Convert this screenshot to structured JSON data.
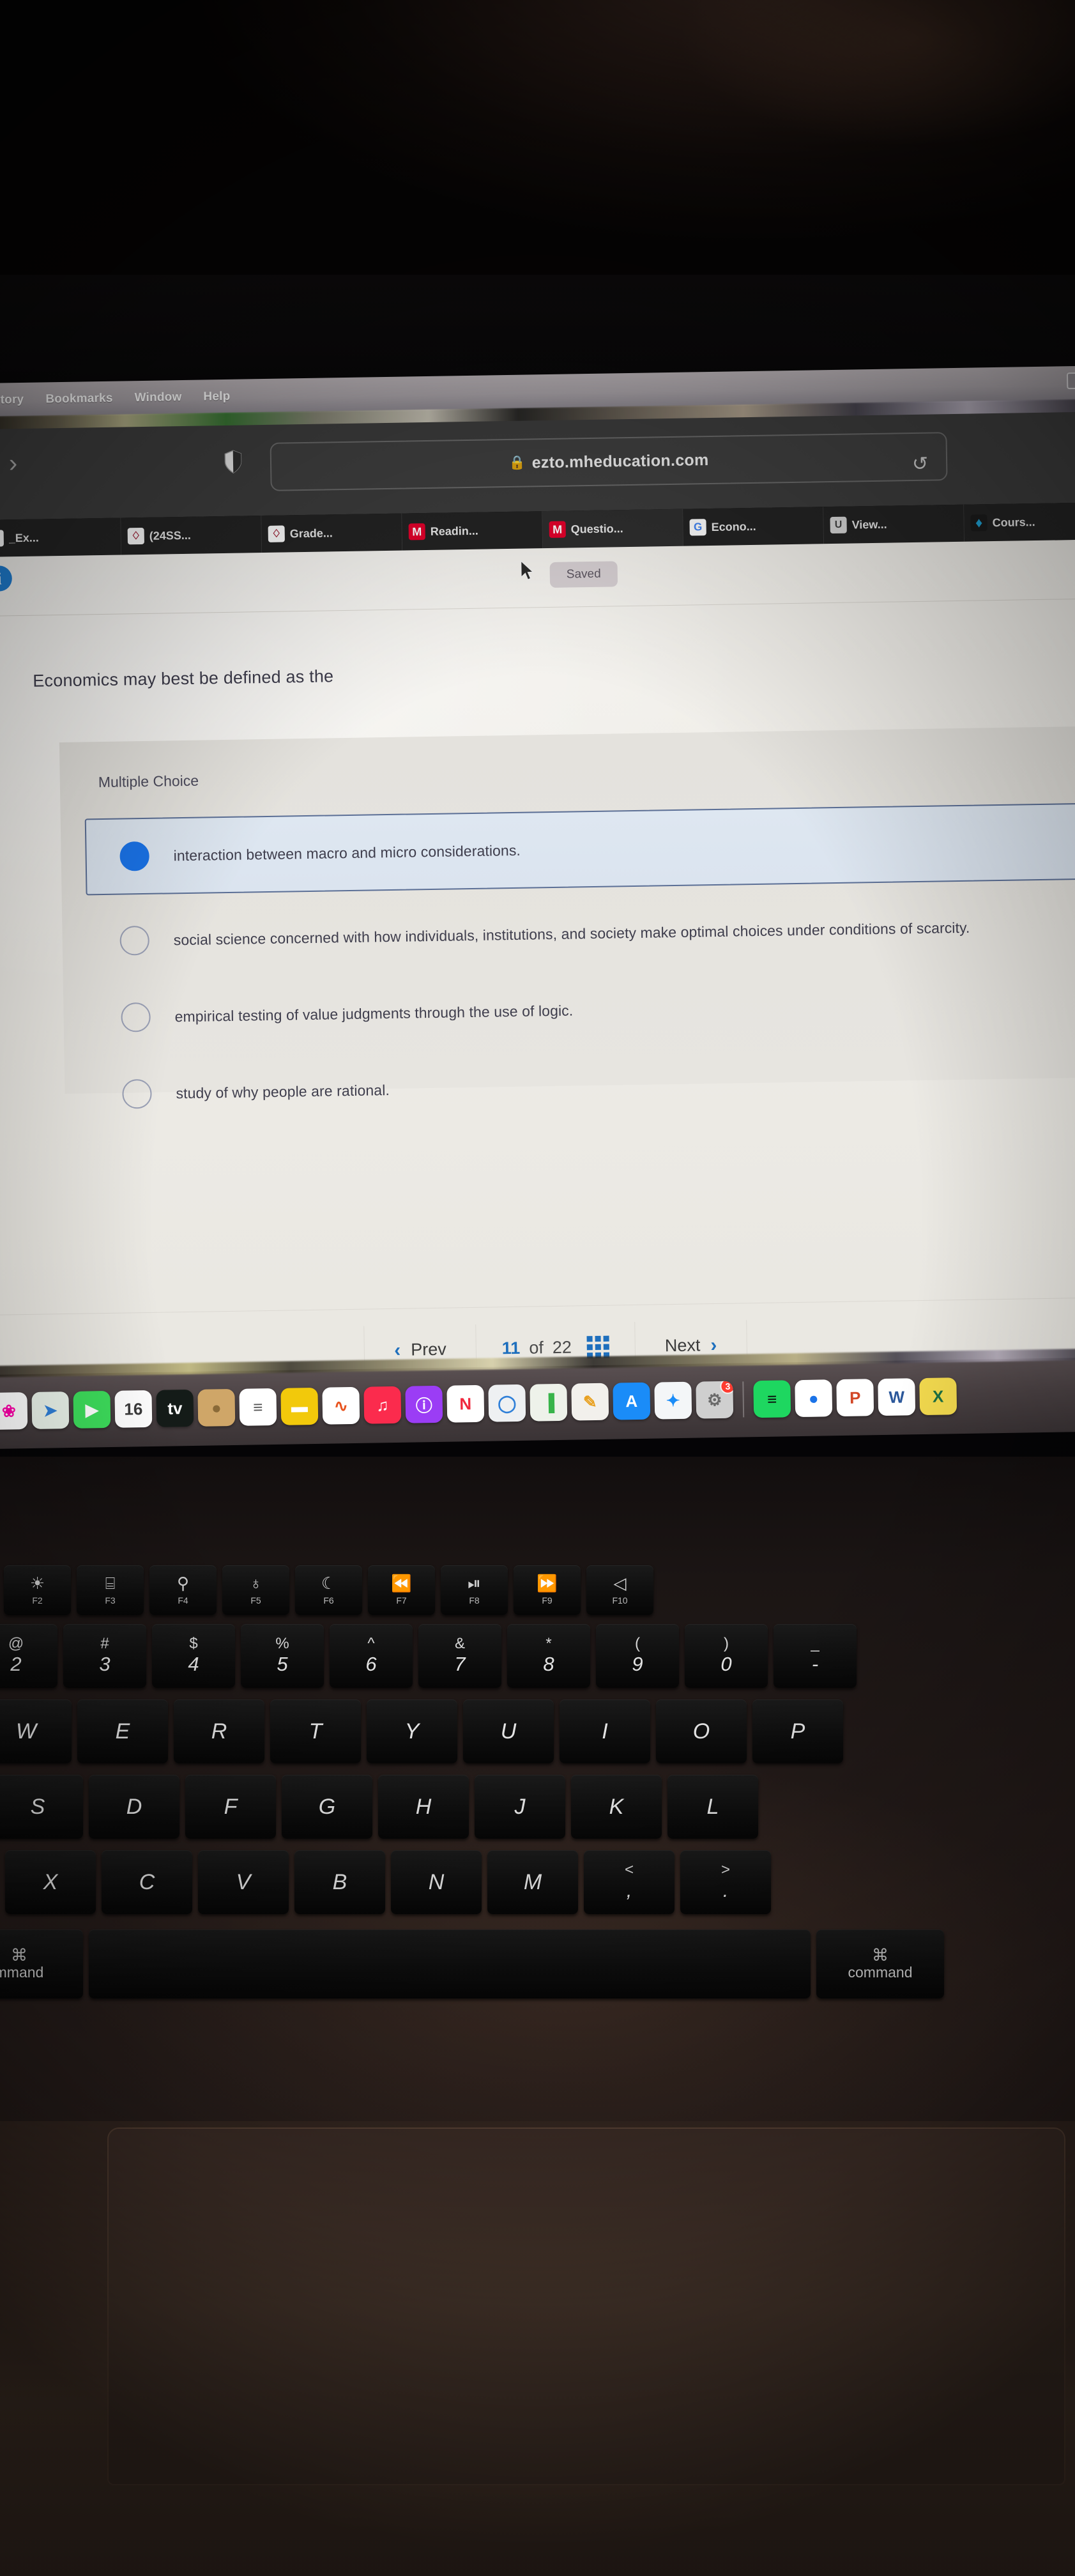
{
  "menubar": {
    "items": [
      "istory",
      "Bookmarks",
      "Window",
      "Help"
    ]
  },
  "browser": {
    "forward_icon": "chevron-right-icon",
    "shield_icon": "shield-icon",
    "lock_icon": "lock-icon",
    "url": "ezto.mheducation.com",
    "reload_icon": "reload-icon",
    "tabs": [
      {
        "label": "_Ex...",
        "favicon": "tamu-icon",
        "active": false
      },
      {
        "label": "(24SS...",
        "favicon": "tamu-icon",
        "active": false
      },
      {
        "label": "Grade...",
        "favicon": "tamu-icon",
        "active": false
      },
      {
        "label": "Readin...",
        "favicon": "mcgrawhill-icon",
        "active": false
      },
      {
        "label": "Questio...",
        "favicon": "mcgrawhill-icon",
        "active": true
      },
      {
        "label": "Econo...",
        "favicon": "google-icon",
        "active": false
      },
      {
        "label": "View...",
        "favicon": "u-icon",
        "active": false
      },
      {
        "label": "Cours...",
        "favicon": "courselogo-icon",
        "active": false
      }
    ]
  },
  "page": {
    "info_icon": "info-icon",
    "save_status": "Saved",
    "question": "Economics may best be defined as the",
    "question_type": "Multiple Choice",
    "options": [
      {
        "text": "interaction between macro and micro considerations.",
        "selected": true
      },
      {
        "text": "social science concerned with how individuals, institutions, and society make optimal choices under conditions of scarcity.",
        "selected": false
      },
      {
        "text": "empirical testing of value judgments through the use of logic.",
        "selected": false
      },
      {
        "text": "study of why people are rational.",
        "selected": false
      }
    ],
    "nav": {
      "prev_label": "Prev",
      "prev_icon": "chevron-left-icon",
      "current": "11",
      "of_label": "of",
      "total": "22",
      "grid_icon": "grid-icon",
      "next_label": "Next",
      "next_icon": "chevron-right-icon"
    },
    "accent_color": "#1a73e8",
    "link_color": "#1e6fbd"
  },
  "dock": {
    "apps": [
      {
        "name": "photos-icon",
        "glyph": "❀",
        "bg": "#ffffff",
        "fg": "#f0a",
        "running": false
      },
      {
        "name": "maps-icon",
        "glyph": "➤",
        "bg": "#eaf3ea",
        "fg": "#2f7fd8",
        "running": true
      },
      {
        "name": "facetime-icon",
        "glyph": "▶",
        "bg": "#3ddc5b",
        "fg": "#ffffff",
        "running": false
      },
      {
        "name": "calendar-icon",
        "glyph": "16",
        "bg": "#ffffff",
        "fg": "#3a3a3a",
        "running": false
      },
      {
        "name": "appletv-icon",
        "glyph": "tv",
        "bg": "#141b18",
        "fg": "#ffffff",
        "running": false
      },
      {
        "name": "contacts-icon",
        "glyph": "●",
        "bg": "#cfa668",
        "fg": "#8a6a38",
        "running": false
      },
      {
        "name": "reminders-icon",
        "glyph": "≡",
        "bg": "#ffffff",
        "fg": "#5a5a5a",
        "running": true
      },
      {
        "name": "notes-icon",
        "glyph": "▬",
        "bg": "#f2c90b",
        "fg": "#ffffff",
        "running": false
      },
      {
        "name": "stocks-icon",
        "glyph": "∿",
        "bg": "#ffffff",
        "fg": "#e8541f",
        "running": true
      },
      {
        "name": "music-icon",
        "glyph": "♫",
        "bg": "#fb2b4d",
        "fg": "#ffffff",
        "running": false
      },
      {
        "name": "podcasts-icon",
        "glyph": "ⓘ",
        "bg": "#9b3df5",
        "fg": "#ffffff",
        "running": false
      },
      {
        "name": "news-icon",
        "glyph": "N",
        "bg": "#ffffff",
        "fg": "#f0293e",
        "running": false
      },
      {
        "name": "keynote-icon",
        "glyph": "◯",
        "bg": "#eef0f2",
        "fg": "#2f7fd8",
        "running": true
      },
      {
        "name": "numbers-icon",
        "glyph": "▐",
        "bg": "#eef2ea",
        "fg": "#38b44a",
        "running": false
      },
      {
        "name": "pages-icon",
        "glyph": "✎",
        "bg": "#f2f0ec",
        "fg": "#e8a020",
        "running": false
      },
      {
        "name": "appstore-icon",
        "glyph": "A",
        "bg": "#1a8cf8",
        "fg": "#ffffff",
        "running": true
      },
      {
        "name": "safari-icon",
        "glyph": "✦",
        "bg": "#f4f6f8",
        "fg": "#1a8cf8",
        "running": true
      },
      {
        "name": "settings-icon",
        "glyph": "⚙",
        "bg": "#cfcfcf",
        "fg": "#6a6a6a",
        "badge": "3",
        "running": false
      },
      {
        "name": "spotify-icon",
        "glyph": "≡",
        "bg": "#1ed760",
        "fg": "#0b0b0b",
        "running": false
      },
      {
        "name": "chrome-icon",
        "glyph": "●",
        "bg": "#ffffff",
        "fg": "#1a73e8",
        "running": false
      },
      {
        "name": "powerpoint-icon",
        "glyph": "P",
        "bg": "#ffffff",
        "fg": "#d24726",
        "running": false
      },
      {
        "name": "word-icon",
        "glyph": "W",
        "bg": "#ffffff",
        "fg": "#2b579a",
        "running": false
      },
      {
        "name": "excel-icon",
        "glyph": "X",
        "bg": "#f2d94e",
        "fg": "#1d6f42",
        "running": false
      }
    ]
  },
  "keyboard": {
    "function_row": [
      {
        "glyph": "☀",
        "label": "F2"
      },
      {
        "glyph": "⌸",
        "label": "F3"
      },
      {
        "glyph": "⚲",
        "label": "F4"
      },
      {
        "glyph": "♁",
        "label": "F5"
      },
      {
        "glyph": "☾",
        "label": "F6"
      },
      {
        "glyph": "⏪",
        "label": "F7"
      },
      {
        "glyph": "⏯",
        "label": "F8"
      },
      {
        "glyph": "⏩",
        "label": "F9"
      },
      {
        "glyph": "◁",
        "label": "F10"
      }
    ],
    "number_row": [
      {
        "top": "@",
        "bot": "2"
      },
      {
        "top": "#",
        "bot": "3"
      },
      {
        "top": "$",
        "bot": "4"
      },
      {
        "top": "%",
        "bot": "5"
      },
      {
        "top": "^",
        "bot": "6"
      },
      {
        "top": "&",
        "bot": "7"
      },
      {
        "top": "*",
        "bot": "8"
      },
      {
        "top": "(",
        "bot": "9"
      },
      {
        "top": ")",
        "bot": "0"
      },
      {
        "top": "_",
        "bot": "-"
      }
    ],
    "row_q": [
      "W",
      "E",
      "R",
      "T",
      "Y",
      "U",
      "I",
      "O",
      "P"
    ],
    "row_a": [
      "S",
      "D",
      "F",
      "G",
      "H",
      "J",
      "K",
      "L"
    ],
    "row_z": [
      "X",
      "C",
      "V",
      "B",
      "N",
      "M"
    ],
    "row_z_punct": [
      {
        "top": "<",
        "bot": ","
      },
      {
        "top": ">",
        "bot": "."
      }
    ],
    "bottom_row": {
      "cmd_glyph": "⌘",
      "left_label": "mmand",
      "right_label": "command"
    }
  }
}
